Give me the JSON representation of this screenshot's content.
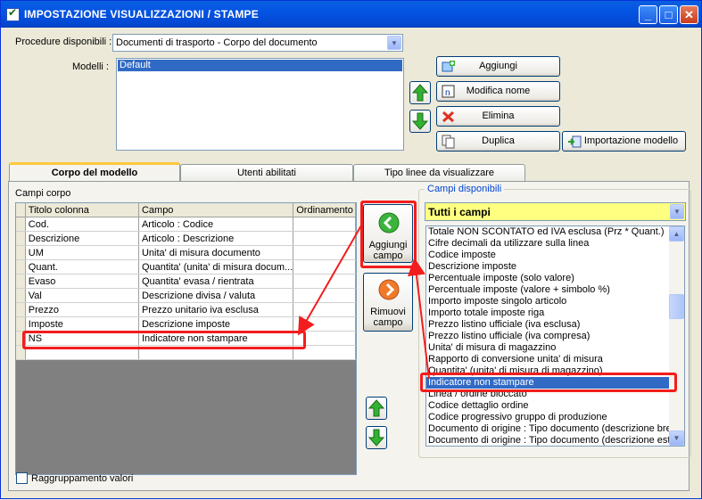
{
  "window": {
    "title": "IMPOSTAZIONE VISUALIZZAZIONI / STAMPE",
    "minimize": "_",
    "maximize": "□",
    "close": "✕"
  },
  "procedure": {
    "label": "Procedure disponibili :",
    "selected": "Documenti di trasporto - Corpo del documento"
  },
  "modelli": {
    "label": "Modelli :",
    "items": [
      "Default"
    ]
  },
  "buttons": {
    "aggiungi": "Aggiungi",
    "modifica": "Modifica nome",
    "elimina": "Elimina",
    "duplica": "Duplica",
    "importazione": "Importazione modello",
    "aggiungi_campo_1": "Aggiungi",
    "aggiungi_campo_2": "campo",
    "rimuovi_campo_1": "Rimuovi",
    "rimuovi_campo_2": "campo"
  },
  "tabs": [
    {
      "label": "Corpo del modello",
      "active": true
    },
    {
      "label": "Utenti abilitati",
      "active": false
    },
    {
      "label": "Tipo linee da visualizzare",
      "active": false
    }
  ],
  "corpo": {
    "label": "Campi corpo",
    "columns": [
      "Titolo colonna",
      "Campo",
      "Ordinamento"
    ],
    "rows": [
      [
        "Cod.",
        "Articolo : Codice",
        ""
      ],
      [
        "Descrizione",
        "Articolo : Descrizione",
        ""
      ],
      [
        "UM",
        "Unita' di misura documento",
        ""
      ],
      [
        "Quant.",
        "Quantita' (unita' di misura docum...",
        ""
      ],
      [
        "Evaso",
        "Quantita' evasa / rientrata",
        ""
      ],
      [
        "Val",
        "Descrizione divisa / valuta",
        ""
      ],
      [
        "Prezzo",
        "Prezzo unitario iva esclusa",
        ""
      ],
      [
        "Imposte",
        "Descrizione imposte",
        ""
      ],
      [
        "NS",
        "Indicatore non stampare",
        ""
      ],
      [
        "",
        "",
        ""
      ]
    ]
  },
  "disponibili": {
    "label": "Campi disponibili",
    "filter": "Tutti i campi",
    "items": [
      "Totale NON SCONTATO ed IVA esclusa (Prz * Quant.)",
      "Cifre decimali da utilizzare sulla linea",
      "Codice imposte",
      "Descrizione imposte",
      "Percentuale imposte (solo valore)",
      "Percentuale imposte (valore + simbolo %)",
      "Importo imposte singolo articolo",
      "Importo totale imposte riga",
      "Prezzo listino ufficiale (iva esclusa)",
      "Prezzo listino ufficiale (iva compresa)",
      "Unita' di misura di magazzino",
      "Rapporto di conversione unita' di misura",
      "Quantita' (unita' di misura di magazzino)",
      "Indicatore non stampare",
      "Linea / ordine bloccato",
      "Codice dettaglio ordine",
      "Codice progressivo gruppo di produzione",
      "Documento di origine : Tipo documento (descrizione breve)",
      "Documento di origine : Tipo documento (descrizione estesa)"
    ],
    "selected_index": 13
  },
  "raggruppamento": {
    "label": "Raggruppamento valori",
    "checked": false
  },
  "colors": {
    "highlight": "#f21d1d",
    "selection": "#316ac5",
    "filter_bg": "#ffff80"
  }
}
